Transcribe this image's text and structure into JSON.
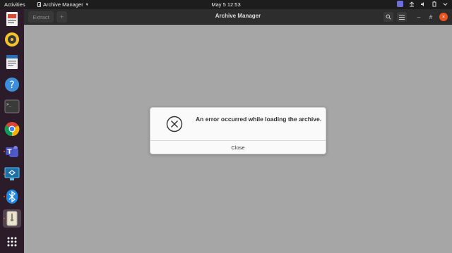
{
  "topbar": {
    "activities": "Activities",
    "app_name": "Archive Manager",
    "clock": "May 5  12:53"
  },
  "dock": {
    "items": [
      {
        "name": "libreoffice-impress-icon"
      },
      {
        "name": "rhythmbox-icon"
      },
      {
        "name": "libreoffice-writer-icon"
      },
      {
        "name": "help-icon"
      },
      {
        "name": "terminal-icon"
      },
      {
        "name": "chrome-icon"
      },
      {
        "name": "teams-icon"
      },
      {
        "name": "remote-desktop-icon"
      },
      {
        "name": "bluetooth-icon"
      },
      {
        "name": "archive-manager-icon"
      },
      {
        "name": "show-apps-icon"
      }
    ],
    "terminal_prompt": ">_"
  },
  "window": {
    "title": "Archive Manager",
    "extract_label": "Extract",
    "add_label": "+",
    "minimize": "–",
    "maximize": "#",
    "close": "×"
  },
  "dialog": {
    "message": "An error occurred while loading the archive.",
    "close_label": "Close"
  },
  "colors": {
    "accent": "#e95420",
    "content_bg": "#a6a6a6",
    "dock_bg": "#2c1b28"
  }
}
